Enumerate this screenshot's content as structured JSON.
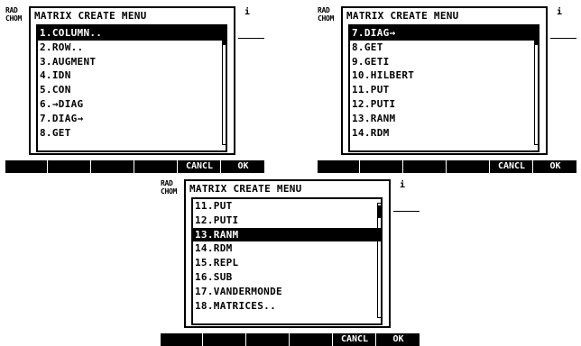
{
  "screens": [
    {
      "status": [
        "RAD",
        "CHOM"
      ],
      "cursor": "i",
      "dialog_title": "MATRIX CREATE MENU",
      "items": [
        {
          "label": "1.COLUMN..",
          "selected": true
        },
        {
          "label": "2.ROW..",
          "selected": false
        },
        {
          "label": "3.AUGMENT",
          "selected": false
        },
        {
          "label": "4.IDN",
          "selected": false
        },
        {
          "label": "5.CON",
          "selected": false
        },
        {
          "label": "6.→DIAG",
          "selected": false
        },
        {
          "label": "7.DIAG→",
          "selected": false
        },
        {
          "label": "8.GET",
          "selected": false
        }
      ],
      "softkeys": [
        "",
        "",
        "",
        "",
        "CANCL",
        "OK"
      ]
    },
    {
      "status": [
        "RAD",
        "CHOM"
      ],
      "cursor": "i",
      "dialog_title": "MATRIX CREATE MENU",
      "items": [
        {
          "label": "7.DIAG→",
          "selected": true
        },
        {
          "label": "8.GET",
          "selected": false
        },
        {
          "label": "9.GETI",
          "selected": false
        },
        {
          "label": "10.HILBERT",
          "selected": false
        },
        {
          "label": "11.PUT",
          "selected": false
        },
        {
          "label": "12.PUTI",
          "selected": false
        },
        {
          "label": "13.RANM",
          "selected": false
        },
        {
          "label": "14.RDM",
          "selected": false
        }
      ],
      "softkeys": [
        "",
        "",
        "",
        "",
        "CANCL",
        "OK"
      ]
    },
    {
      "status": [
        "RAD",
        "CHOM"
      ],
      "cursor": "i",
      "dialog_title": "MATRIX CREATE MENU",
      "items": [
        {
          "label": "11.PUT",
          "selected": false
        },
        {
          "label": "12.PUTI",
          "selected": false
        },
        {
          "label": "13.RANM",
          "selected": true
        },
        {
          "label": "14.RDM",
          "selected": false
        },
        {
          "label": "15.REPL",
          "selected": false
        },
        {
          "label": "16.SUB",
          "selected": false
        },
        {
          "label": "17.VANDERMONDE",
          "selected": false
        },
        {
          "label": "18.MATRICES..",
          "selected": false
        }
      ],
      "softkeys": [
        "",
        "",
        "",
        "",
        "CANCL",
        "OK"
      ]
    }
  ]
}
